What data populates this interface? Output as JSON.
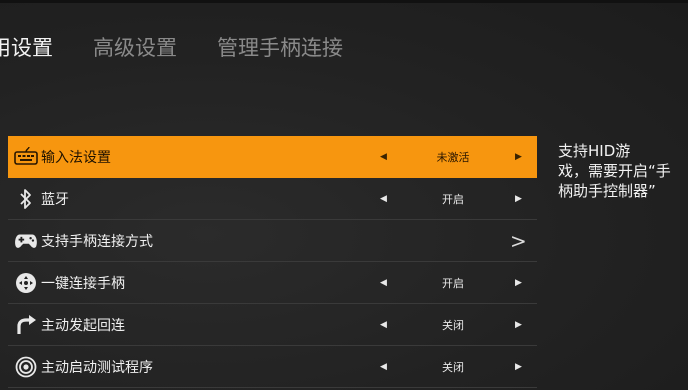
{
  "tabs": [
    {
      "label": "用设置"
    },
    {
      "label": "高级设置"
    },
    {
      "label": "管理手柄连接"
    }
  ],
  "settings": [
    {
      "label": "输入法设置",
      "value": "未激活",
      "left_arrow": "◀",
      "right_arrow": "▶",
      "icon": "keyboard-icon"
    },
    {
      "label": "蓝牙",
      "value": "开启",
      "left_arrow": "◀",
      "right_arrow": "▶",
      "icon": "bluetooth-icon"
    },
    {
      "label": "支持手柄连接方式",
      "more": ">",
      "icon": "gamepad-icon"
    },
    {
      "label": "一键连接手柄",
      "value": "开启",
      "left_arrow": "◀",
      "right_arrow": "▶",
      "icon": "dpad-icon"
    },
    {
      "label": "主动发起回连",
      "value": "关闭",
      "left_arrow": "◀",
      "right_arrow": "▶",
      "icon": "reconnect-icon"
    },
    {
      "label": "主动启动测试程序",
      "value": "关闭",
      "left_arrow": "◀",
      "right_arrow": "▶",
      "icon": "target-icon"
    }
  ],
  "side_note": "支持HID游\n戏，需要开启“手\n柄助手控制器”",
  "colors": {
    "accent": "#f7960f",
    "background": "#222222"
  }
}
